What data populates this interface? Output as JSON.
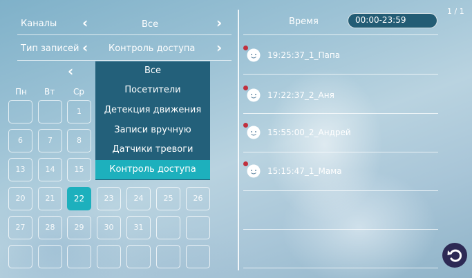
{
  "channels": {
    "label": "Каналы",
    "value": "Все"
  },
  "record_type": {
    "label": "Тип записей",
    "value": "Контроль доступа"
  },
  "calendar": {
    "weekdays": [
      "Пн",
      "Вт",
      "Ср"
    ],
    "days": [
      "1",
      "6",
      "7",
      "8",
      "13",
      "14",
      "15",
      "20",
      "21",
      "22",
      "23",
      "24",
      "25",
      "26",
      "27",
      "28",
      "29",
      "30",
      "31"
    ],
    "selected_day": "22"
  },
  "dropdown": {
    "items": [
      "Все",
      "Посетители",
      "Детекция движения",
      "Записи вручную",
      "Датчики тревоги",
      "Контроль доступа"
    ],
    "active_index": 5
  },
  "time_filter": {
    "label": "Время",
    "value": "00:00-23:59"
  },
  "pagination": "1 / 1",
  "records": [
    {
      "label": "19:25:37_1_Папа",
      "unread": true
    },
    {
      "label": "17:22:37_2_Аня",
      "unread": true
    },
    {
      "label": "15:55:00_2_Андрей",
      "unread": true
    },
    {
      "label": "15:15:47_1_Мама",
      "unread": true
    }
  ],
  "icons": {
    "avatar": "baby-face-icon",
    "back": "back-arrow-icon",
    "unread_dot": "#c0303e",
    "accent": "#1db0bd"
  }
}
